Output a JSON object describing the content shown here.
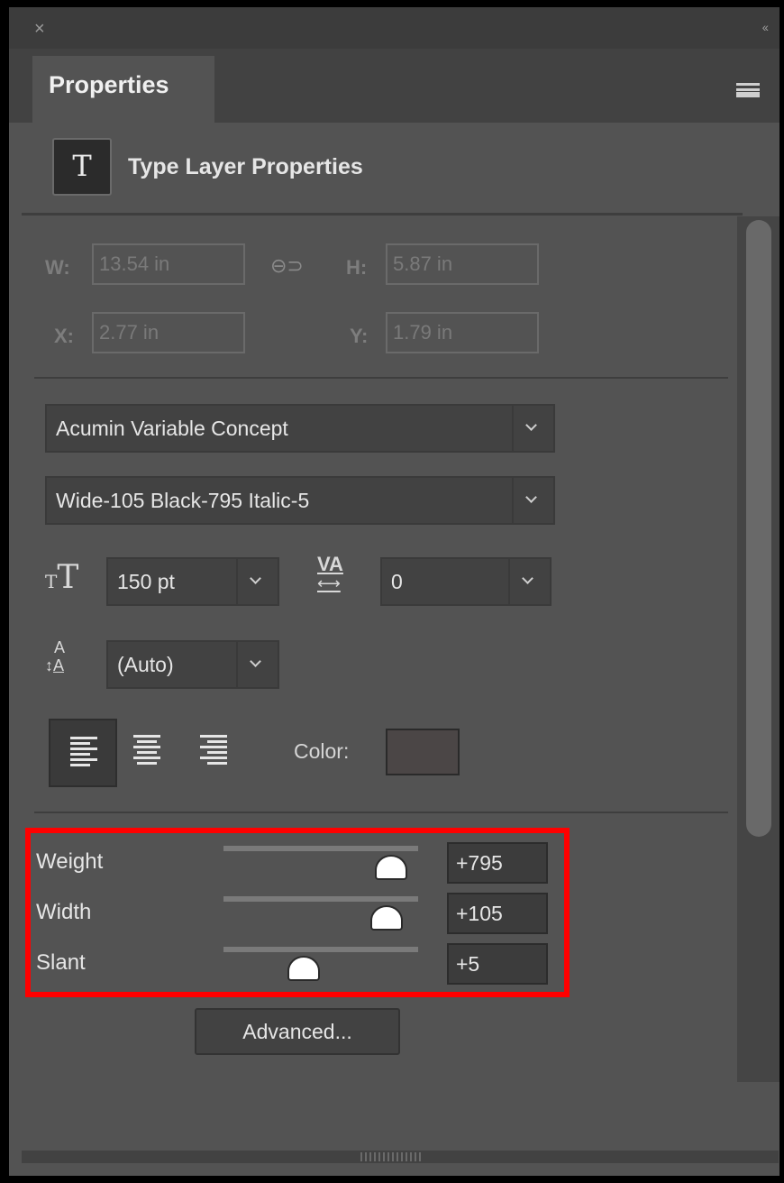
{
  "window": {
    "close_glyph": "×",
    "collapse_glyph": "‹‹"
  },
  "tabs": [
    {
      "label": "Properties"
    }
  ],
  "header": {
    "icon_glyph": "T",
    "title": "Type Layer Properties"
  },
  "transform": {
    "w_label": "W:",
    "w_value": "13.54 in",
    "h_label": "H:",
    "h_value": "5.87 in",
    "x_label": "X:",
    "x_value": "2.77 in",
    "y_label": "Y:",
    "y_value": "1.79 in"
  },
  "character": {
    "font_family": "Acumin Variable Concept",
    "font_style": "Wide-105 Black-795 Italic-5",
    "font_size": "150 pt",
    "tracking": "0",
    "leading": "(Auto)",
    "color_label": "Color:",
    "color_value": "#4b4646"
  },
  "variable_axes": [
    {
      "label": "Weight",
      "value": "+795",
      "slider_fraction": 0.86
    },
    {
      "label": "Width",
      "value": "+105",
      "slider_fraction": 0.84
    },
    {
      "label": "Slant",
      "value": "+5",
      "slider_fraction": 0.41
    }
  ],
  "advanced_button": "Advanced..."
}
